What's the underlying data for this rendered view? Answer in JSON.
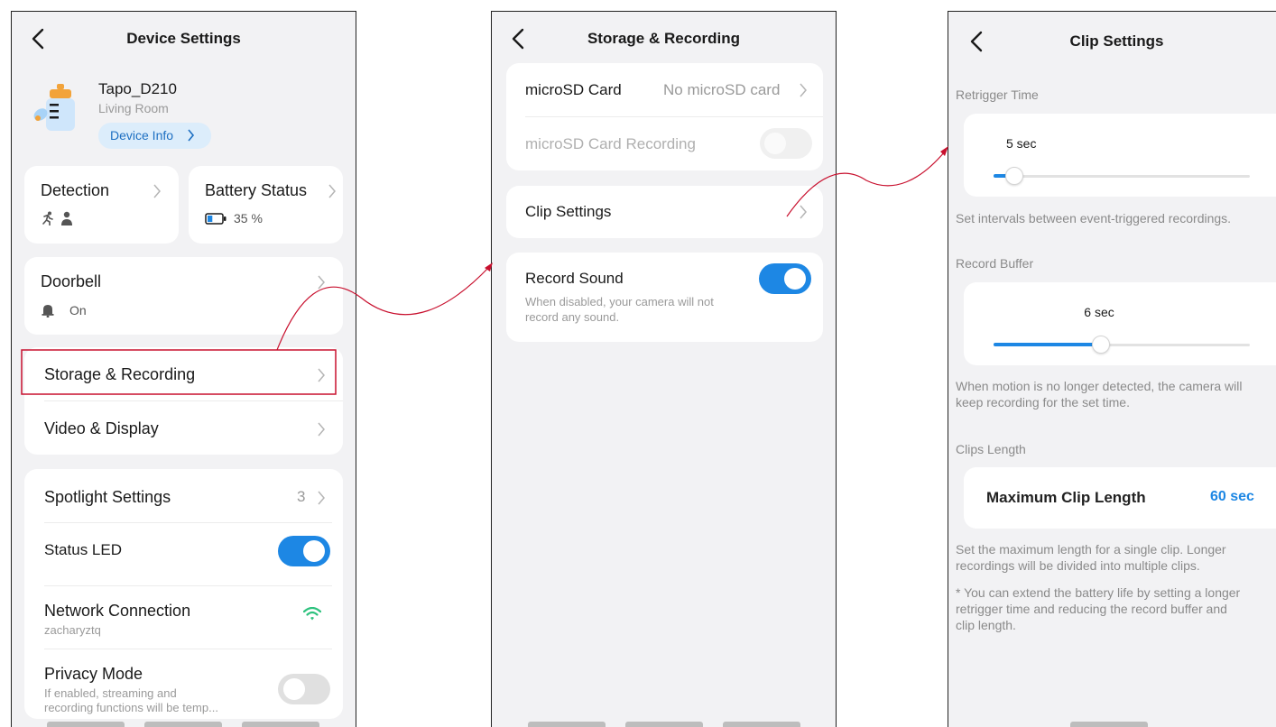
{
  "colors": {
    "accent": "#1d87e4",
    "annotation": "#c8102e",
    "wifi": "#2ec27e"
  },
  "screen1": {
    "title": "Device Settings",
    "device": {
      "name": "Tapo_D210",
      "room": "Living Room",
      "info_label": "Device Info"
    },
    "detection": {
      "label": "Detection",
      "icons": [
        "running-person-icon",
        "person-icon"
      ]
    },
    "battery": {
      "label": "Battery Status",
      "value": "35 %",
      "level": 0.35
    },
    "doorbell": {
      "label": "Doorbell",
      "status": "On"
    },
    "storage_label": "Storage & Recording",
    "video_label": "Video & Display",
    "spotlight": {
      "label": "Spotlight Settings",
      "count": "3"
    },
    "status_led": {
      "label": "Status LED",
      "on": true
    },
    "network": {
      "label": "Network Connection",
      "ssid": "zacharyztq"
    },
    "privacy": {
      "label": "Privacy Mode",
      "desc_line1": "If enabled, streaming and",
      "desc_line2": "recording functions will be temp...",
      "on": false
    }
  },
  "screen2": {
    "title": "Storage & Recording",
    "microsd": {
      "label": "microSD Card",
      "value": "No microSD card"
    },
    "microsd_recording": {
      "label": "microSD Card Recording",
      "enabled": false
    },
    "clip_settings_label": "Clip Settings",
    "record_sound": {
      "label": "Record Sound",
      "desc_line1": "When disabled, your camera will not",
      "desc_line2": "record any sound.",
      "on": true
    }
  },
  "screen3": {
    "title": "Clip Settings",
    "retrigger": {
      "section": "Retrigger Time",
      "value": "5 sec",
      "fraction": 0.08,
      "desc": "Set intervals between event-triggered recordings."
    },
    "buffer": {
      "section": "Record Buffer",
      "value": "6 sec",
      "fraction": 0.42,
      "desc_line1": "When motion is no longer detected, the camera will",
      "desc_line2": "keep recording for the set time."
    },
    "clips": {
      "section": "Clips Length",
      "label": "Maximum Clip Length",
      "value": "60 sec",
      "desc_line1": "Set the maximum length for a single clip. Longer",
      "desc_line2": "recordings will be divided into multiple clips.",
      "note_line1": "* You can extend the battery life by setting a longer",
      "note_line2": "retrigger time and reducing the record buffer and",
      "note_line3": "clip length."
    }
  }
}
